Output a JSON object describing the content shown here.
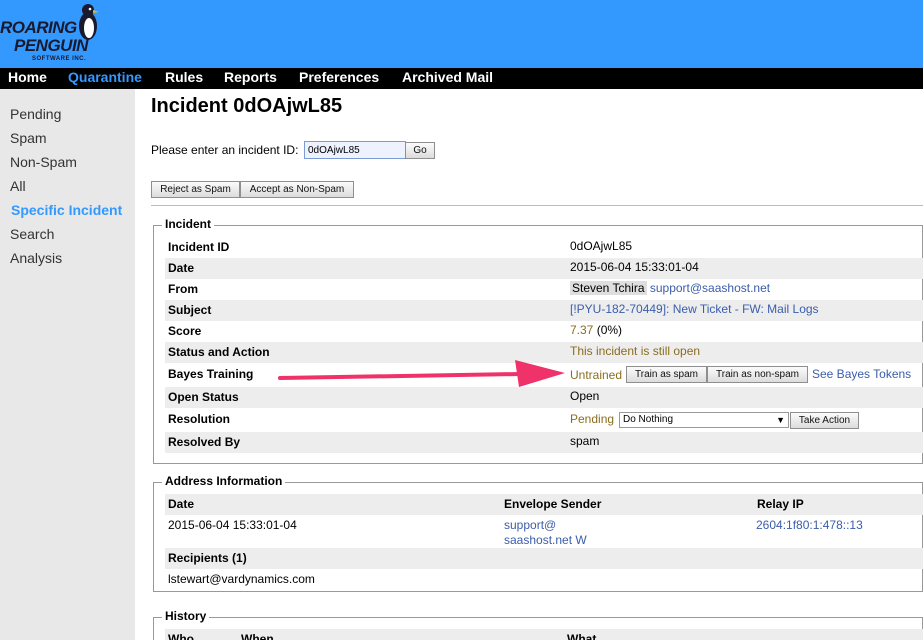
{
  "brand": {
    "line1": "ROARING",
    "line2": "PENGUIN",
    "line3": "SOFTWARE INC."
  },
  "nav": [
    "Home",
    "Quarantine",
    "Rules",
    "Reports",
    "Preferences",
    "Archived Mail"
  ],
  "sidebar": [
    "Pending",
    "Spam",
    "Non-Spam",
    "All",
    "Specific Incident",
    "Search",
    "Analysis"
  ],
  "page": {
    "title": "Incident 0dOAjwL85",
    "id_prompt": "Please enter an incident ID:",
    "id_value": "0dOAjwL85",
    "go_label": "Go",
    "reject_label": "Reject as Spam",
    "accept_label": "Accept as Non-Spam"
  },
  "incident": {
    "legend": "Incident",
    "labels": {
      "id": "Incident ID",
      "date": "Date",
      "from": "From",
      "subject": "Subject",
      "score": "Score",
      "status": "Status and Action",
      "bayes": "Bayes Training",
      "open": "Open Status",
      "resolution": "Resolution",
      "resolved_by": "Resolved By"
    },
    "values": {
      "id": "0dOAjwL85",
      "date": "2015-06-04 15:33:01-04",
      "from_name": "Steven Tchira",
      "from_email": "support@saashost.net",
      "subject": "[!PYU-182-70449]: New Ticket - FW: Mail Logs",
      "score": "7.37",
      "score_pct": "(0%)",
      "status": "This incident is still open",
      "bayes_state": "Untrained",
      "train_spam": "Train as spam",
      "train_nonspam": "Train as non-spam",
      "bayes_tokens": "See Bayes Tokens",
      "open": "Open",
      "resolution_state": "Pending",
      "resolution_select": "Do Nothing",
      "take_action": "Take Action",
      "resolved_by": "spam"
    }
  },
  "address": {
    "legend": "Address Information",
    "headers": [
      "Date",
      "Envelope Sender",
      "Relay IP"
    ],
    "date": "2015-06-04 15:33:01-04",
    "sender_line1": "support@",
    "sender_line2": "saashost.net W",
    "relay_ip": "2604:1f80:1:478::13",
    "recipients_label": "Recipients (1)",
    "recipient": "lstewart@vardynamics.com"
  },
  "history": {
    "legend": "History",
    "headers": [
      "Who",
      "When",
      "What"
    ]
  },
  "colors": {
    "header": "#3399ff",
    "nav": "#000000",
    "active": "#3399ff",
    "arrow": "#f0326b",
    "olive": "#8b6d1f",
    "link": "#3b5dab"
  }
}
